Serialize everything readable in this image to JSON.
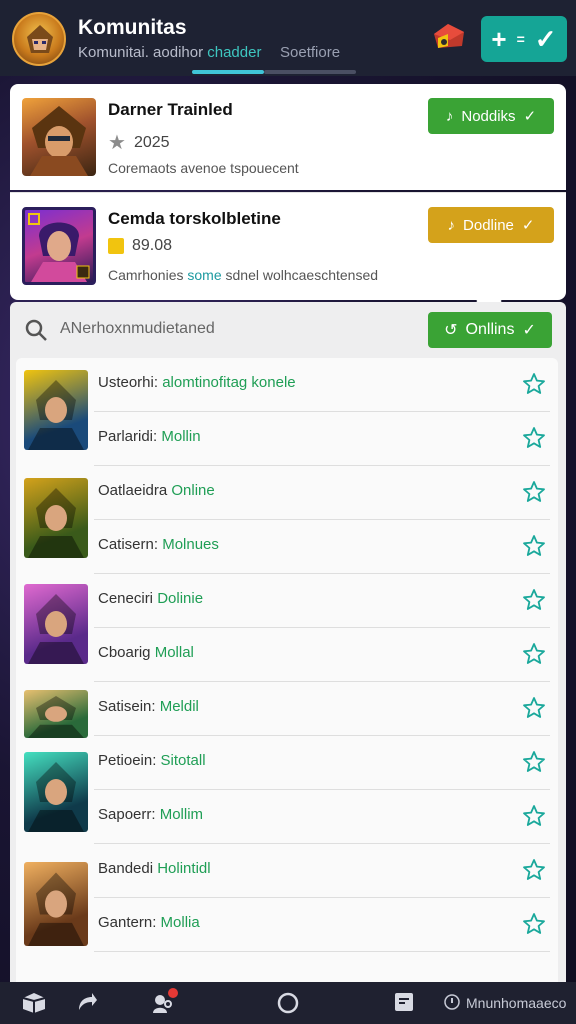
{
  "header": {
    "title": "Komunitas",
    "tab_active_prefix": "Komunitai. aodihor ",
    "tab_active_highlight": "chadder",
    "tab_second": "Soetfiore"
  },
  "featured": [
    {
      "title": "Darner Trainled",
      "meta_value": "2025",
      "description": "Coremaots avenoe tspouecent",
      "button_label": "Noddiks",
      "button_color": "#3aa335"
    },
    {
      "title": "Cemda torskolbletine",
      "meta_value": "89.08",
      "description_prefix": "Camrhonies ",
      "description_highlight": "some",
      "description_suffix": " sdnel wolhcaeschtensed",
      "button_label": "Dodline",
      "button_color": "#d4a21b"
    }
  ],
  "search": {
    "text": "ANerhoxnmudietaned",
    "filter_label": "Onllins"
  },
  "list": [
    {
      "name": "Usteorhi:",
      "status": "alomtinofitag konele"
    },
    {
      "name": "Parlaridi:",
      "status": "Mollin"
    },
    {
      "name": "Oatlaeidra",
      "status": "Online"
    },
    {
      "name": "Catisern:",
      "status": "Molnues"
    },
    {
      "name": "Ceneciri",
      "status": "Dolinie"
    },
    {
      "name": "Cboarig",
      "status": "Mollal"
    },
    {
      "name": "Satisein:",
      "status": "Meldil"
    },
    {
      "name": "Petioein:",
      "status": "Sitotall"
    },
    {
      "name": "Sapoerr:",
      "status": "Mollim"
    },
    {
      "name": "Bandedi",
      "status": "Holintidl"
    },
    {
      "name": "Gantern:",
      "status": "Mollia"
    }
  ],
  "bottom_nav": {
    "label": "Mnunhomaaeco"
  },
  "colors": {
    "accent": "#15a596",
    "online": "#1f9e55",
    "star": "#1aa89b"
  }
}
